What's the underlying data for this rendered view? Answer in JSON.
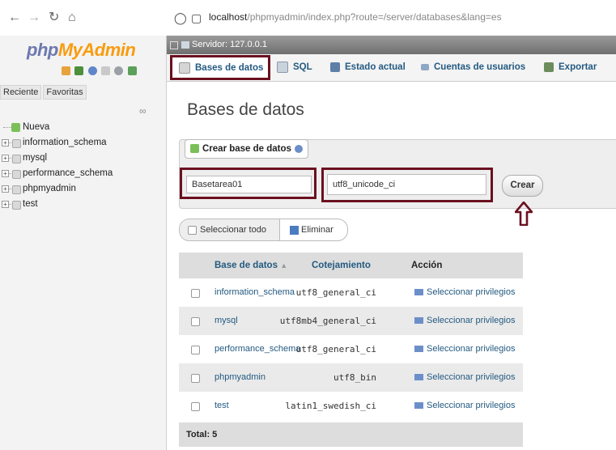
{
  "browser": {
    "url_host": "localhost",
    "url_path": "/phpmyadmin/index.php?route=/server/databases&lang=es"
  },
  "sidebar": {
    "logo_php": "php",
    "logo_myadmin": "MyAdmin",
    "tabs": [
      "Reciente",
      "Favoritas"
    ],
    "items": [
      {
        "label": "Nueva",
        "icon": "new-db-icon"
      },
      {
        "label": "information_schema",
        "icon": "database-icon"
      },
      {
        "label": "mysql",
        "icon": "database-icon"
      },
      {
        "label": "performance_schema",
        "icon": "database-icon"
      },
      {
        "label": "phpmyadmin",
        "icon": "database-icon"
      },
      {
        "label": "test",
        "icon": "database-icon"
      }
    ]
  },
  "server": {
    "label": "Servidor: 127.0.0.1"
  },
  "menu": {
    "items": [
      {
        "label": "Bases de datos",
        "icon": "database-icon",
        "active": true
      },
      {
        "label": "SQL",
        "icon": "sql-icon"
      },
      {
        "label": "Estado actual",
        "icon": "status-icon"
      },
      {
        "label": "Cuentas de usuarios",
        "icon": "users-icon"
      },
      {
        "label": "Exportar",
        "icon": "export-icon"
      }
    ]
  },
  "page": {
    "title": "Bases de datos",
    "create_legend": "Crear base de datos",
    "db_name_value": "Basetarea01",
    "collation_value": "utf8_unicode_ci",
    "create_button": "Crear",
    "select_all": "Seleccionar todo",
    "delete": "Eliminar"
  },
  "table": {
    "headers": [
      "Base de datos",
      "Cotejamiento",
      "Acción"
    ],
    "rows": [
      {
        "name": "information_schema",
        "collation": "utf8_general_ci",
        "action": "Seleccionar privilegios"
      },
      {
        "name": "mysql",
        "collation": "utf8mb4_general_ci",
        "action": "Seleccionar privilegios"
      },
      {
        "name": "performance_schema",
        "collation": "utf8_general_ci",
        "action": "Seleccionar privilegios"
      },
      {
        "name": "phpmyadmin",
        "collation": "utf8_bin",
        "action": "Seleccionar privilegios"
      },
      {
        "name": "test",
        "collation": "latin1_swedish_ci",
        "action": "Seleccionar privilegios"
      }
    ],
    "total": "Total: 5"
  },
  "colors": {
    "highlight": "#6b1020",
    "link": "#235a81",
    "logo_php": "#6c78af",
    "logo_myadmin": "#f89c0e"
  }
}
